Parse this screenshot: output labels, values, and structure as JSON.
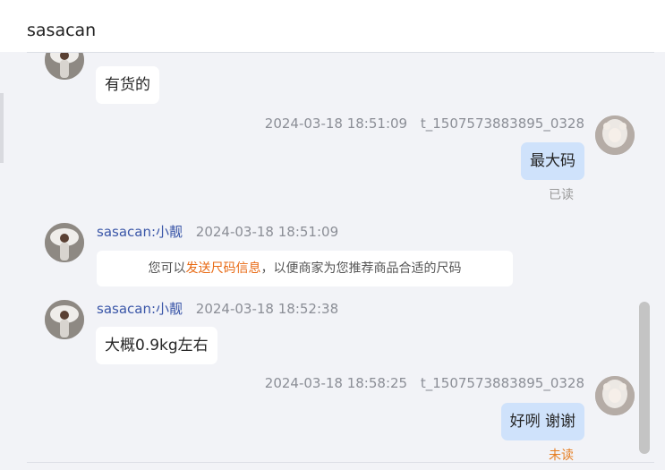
{
  "header": {
    "title": "sasacan"
  },
  "messages": [
    {
      "direction": "in",
      "text": "有货的"
    },
    {
      "direction": "out",
      "time": "2024-03-18 18:51:09",
      "sender_id": "t_1507573883895_0328",
      "text": "最大码",
      "status": "已读"
    },
    {
      "direction": "in",
      "sender": "sasacan:小靓",
      "time": "2024-03-18 18:51:09",
      "system": {
        "prefix": "您可以",
        "link": "发送尺码信息",
        "suffix": "，以便商家为您推荐商品合适的尺码"
      }
    },
    {
      "direction": "in",
      "sender": "sasacan:小靓",
      "time": "2024-03-18 18:52:38",
      "text": "大概0.9kg左右"
    },
    {
      "direction": "out",
      "time": "2024-03-18 18:58:25",
      "sender_id": "t_1507573883895_0328",
      "text": "好咧 谢谢",
      "status": "未读"
    }
  ],
  "colors": {
    "background": "#f2f3f7",
    "bubble_in": "#ffffff",
    "bubble_out": "#cfe2fb",
    "sender_name": "#3a56a8",
    "system_link": "#e86a14",
    "unread": "#e67e22",
    "read": "#999999"
  },
  "icons": {
    "shop_avatar": "shop-avatar-icon",
    "user_avatar": "user-avatar-icon"
  }
}
